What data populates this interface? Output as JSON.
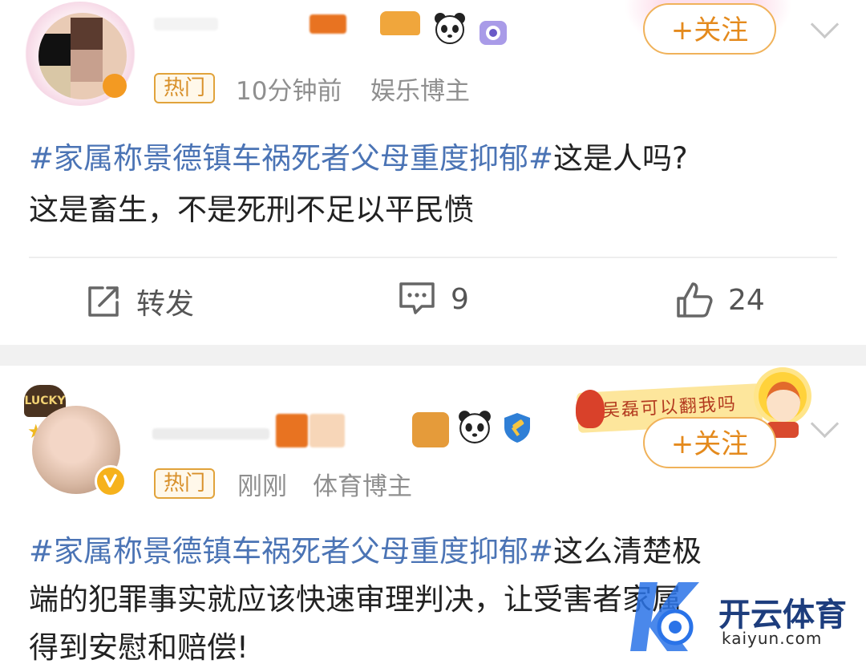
{
  "posts": [
    {
      "badge": "热门",
      "time": "10分钟前",
      "role": "娱乐博主",
      "follow": "+关注",
      "hashtag": "#家属称景德镇车祸死者父母重度抑郁#",
      "text_line1": "这是人吗?",
      "text_line2": "这是畜生，不是死刑不足以平民愤",
      "repost_label": "转发",
      "comments": "9",
      "likes": "24"
    },
    {
      "badge": "热门",
      "time": "刚刚",
      "role": "体育博主",
      "follow": "+关注",
      "banner": "吴磊可以翻我吗",
      "hashtag": "#家属称景德镇车祸死者父母重度抑郁#",
      "text_line1": "这么清楚极",
      "text_line2": "端的犯罪事实就应该快速审理判决，让受害者家属",
      "text_line3": "得到安慰和赔偿!"
    }
  ],
  "watermark": {
    "brand_cn": "开云体育",
    "brand_en": "kaiyun.com"
  },
  "colors": {
    "hashtag": "#4b74b5",
    "follow": "#e48a1d",
    "badge": "#d8902a",
    "meta": "#8f8f8f"
  }
}
